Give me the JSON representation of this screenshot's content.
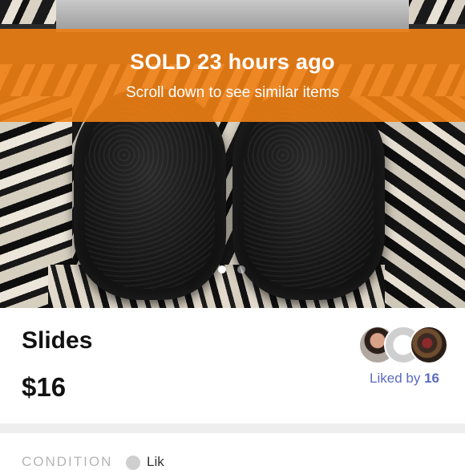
{
  "banner": {
    "status": "SOLD 23 hours ago",
    "subtitle": "Scroll down to see similar items"
  },
  "carousel": {
    "current_index": 1,
    "total": 2
  },
  "listing": {
    "title": "Slides",
    "price": "$16",
    "liked_prefix": "Liked by",
    "liked_count": "16"
  },
  "details": {
    "condition_label": "CONDITION",
    "condition_value": "Lik"
  },
  "colors": {
    "banner": "#f08014",
    "liked_text": "#5b6bbf"
  }
}
